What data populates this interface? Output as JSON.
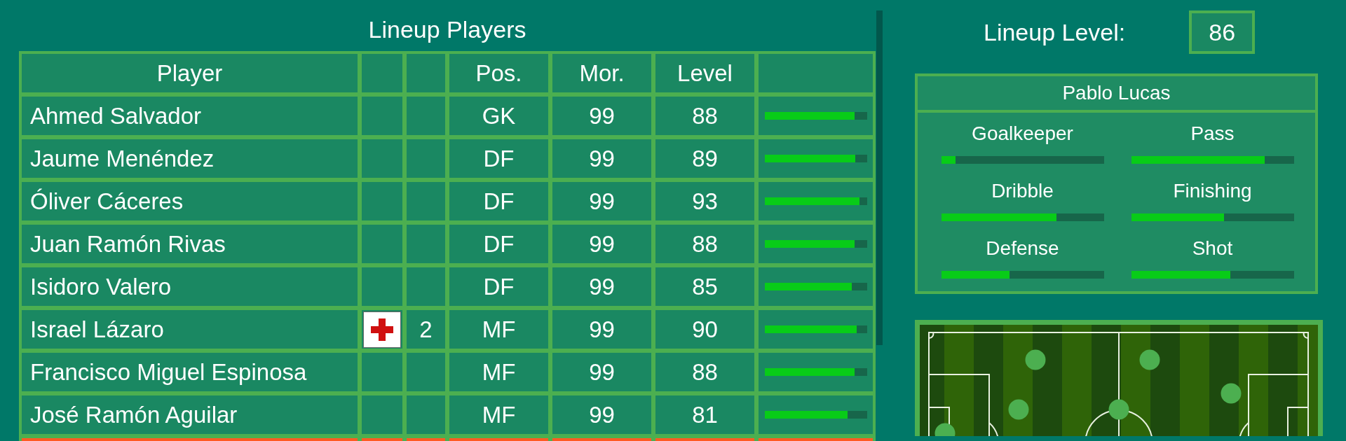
{
  "lineup": {
    "title": "Lineup Players",
    "columns": [
      "Player",
      "",
      "",
      "Pos.",
      "Mor.",
      "Level",
      ""
    ],
    "rows": [
      {
        "name": "Ahmed Salvador",
        "injured": false,
        "position": "GK",
        "morale": "99",
        "level_text": "88",
        "level": 0.88
      },
      {
        "name": "Jaume Menéndez",
        "injured": false,
        "position": "DF",
        "morale": "99",
        "level_text": "89",
        "level": 0.89
      },
      {
        "name": "Óliver Cáceres",
        "injured": false,
        "position": "DF",
        "morale": "99",
        "level_text": "93",
        "level": 0.93
      },
      {
        "name": "Juan Ramón Rivas",
        "injured": false,
        "position": "DF",
        "morale": "99",
        "level_text": "88",
        "level": 0.88
      },
      {
        "name": "Isidoro Valero",
        "injured": false,
        "position": "DF",
        "morale": "99",
        "level_text": "85",
        "level": 0.85
      },
      {
        "name": "Israel Lázaro",
        "injured": true,
        "games_out": "2",
        "position": "MF",
        "morale": "99",
        "level_text": "90",
        "level": 0.9
      },
      {
        "name": "Francisco Miguel Espinosa",
        "injured": false,
        "position": "MF",
        "morale": "99",
        "level_text": "88",
        "level": 0.88
      },
      {
        "name": "José Ramón Aguilar",
        "injured": false,
        "position": "MF",
        "morale": "99",
        "level_text": "81",
        "level": 0.81
      }
    ],
    "partial_row": {
      "selected": true
    }
  },
  "lineup_level": {
    "label": "Lineup Level:",
    "value": "86"
  },
  "player_card": {
    "name": "Pablo Lucas",
    "skills": [
      {
        "name": "Goalkeeper",
        "level": 0.09
      },
      {
        "name": "Pass",
        "level": 0.82
      },
      {
        "name": "Dribble",
        "level": 0.71
      },
      {
        "name": "Finishing",
        "level": 0.57
      },
      {
        "name": "Defense",
        "level": 0.42
      },
      {
        "name": "Shot",
        "level": 0.61
      }
    ]
  }
}
